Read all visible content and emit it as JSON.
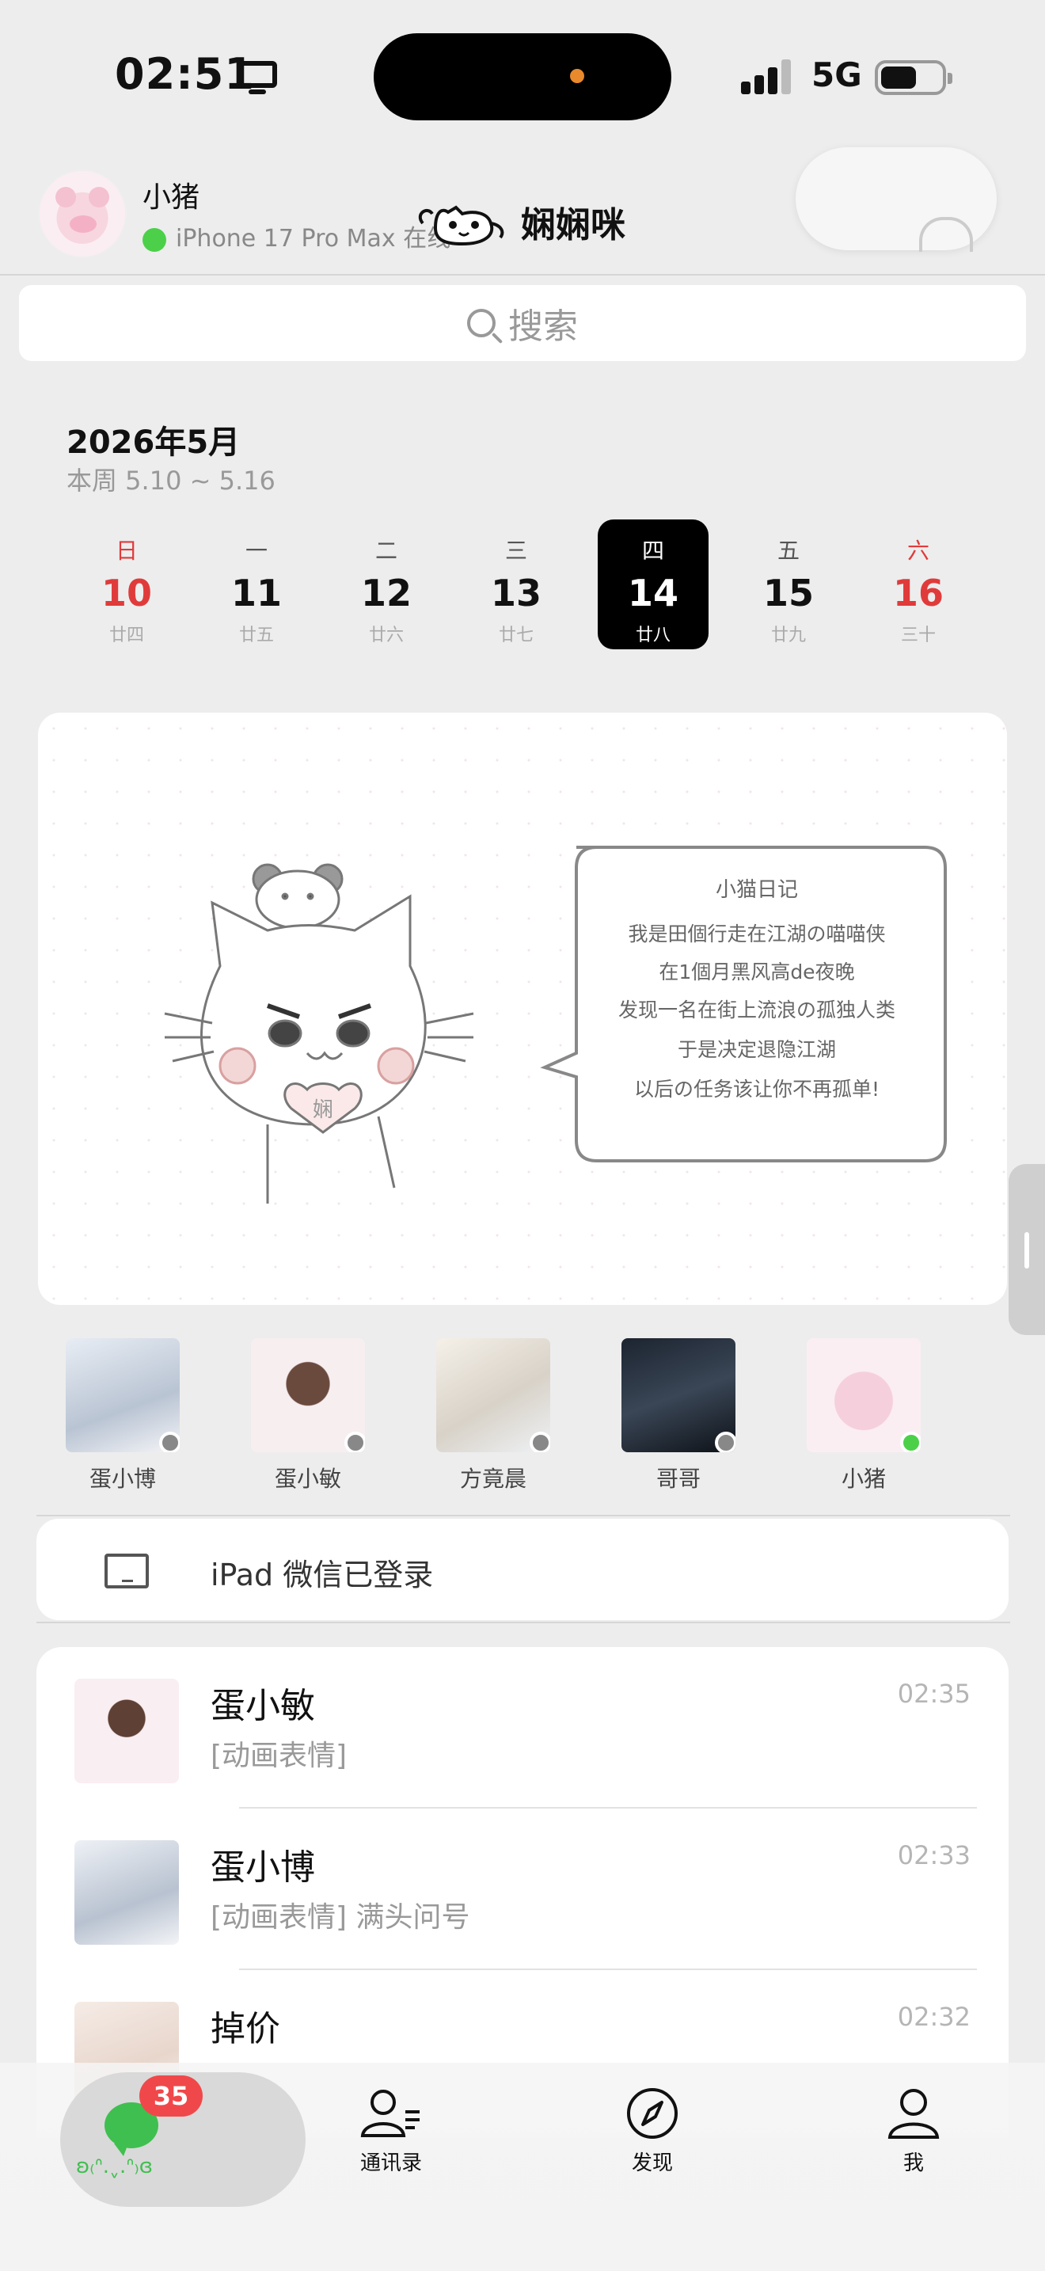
{
  "status_bar": {
    "time": "02:51",
    "network": "5G"
  },
  "header": {
    "user_name": "小猪",
    "user_status": "iPhone 17 Pro Max 在线",
    "brand_name": "娴娴咪"
  },
  "search": {
    "placeholder": "搜索"
  },
  "calendar": {
    "month_title": "2026年5月",
    "week_range": "本周 5.10 ~ 5.16",
    "days": [
      {
        "weekday": "日",
        "date": "10",
        "lunar": "廿四",
        "holiday": true
      },
      {
        "weekday": "一",
        "date": "11",
        "lunar": "廿五"
      },
      {
        "weekday": "二",
        "date": "12",
        "lunar": "廿六"
      },
      {
        "weekday": "三",
        "date": "13",
        "lunar": "廿七"
      },
      {
        "weekday": "四",
        "date": "14",
        "lunar": "廿八",
        "selected": true
      },
      {
        "weekday": "五",
        "date": "15",
        "lunar": "廿九"
      },
      {
        "weekday": "六",
        "date": "16",
        "lunar": "三十",
        "holiday": true
      }
    ]
  },
  "diary": {
    "title": "小猫日记",
    "lines": [
      "我是田個行走在江湖の喵喵侠",
      "在1個月黑风高de夜晚",
      "发现一名在街上流浪の孤独人类",
      "于是决定退隐江湖",
      "以后の任务该让你不再孤单!"
    ],
    "heart_text": "娴"
  },
  "contacts": [
    {
      "name": "蛋小博",
      "status_color": "#888888"
    },
    {
      "name": "蛋小敏",
      "status_color": "#888888"
    },
    {
      "name": "方竟晨",
      "status_color": "#888888"
    },
    {
      "name": "哥哥",
      "status_color": "#888888"
    },
    {
      "name": "小猪",
      "status_color": "#4cd04a"
    }
  ],
  "device_login": {
    "text": "iPad 微信已登录"
  },
  "chats": [
    {
      "name": "蛋小敏",
      "message": "[动画表情]",
      "time": "02:35"
    },
    {
      "name": "蛋小博",
      "message": "[动画表情] 满头问号",
      "time": "02:33"
    },
    {
      "name": "掉价",
      "message": "",
      "time": "02:32"
    }
  ],
  "tabbar": {
    "unread_badge": "35",
    "chats_label": "ʚ₍ᐢ.ˬ.ᐢ₎ɞ",
    "contacts_label": "通讯录",
    "discover_label": "发现",
    "me_label": "我"
  },
  "colors": {
    "accent_green": "#3fbf4f",
    "badge_red": "#f0484a",
    "holiday_red": "#e03b3b"
  }
}
